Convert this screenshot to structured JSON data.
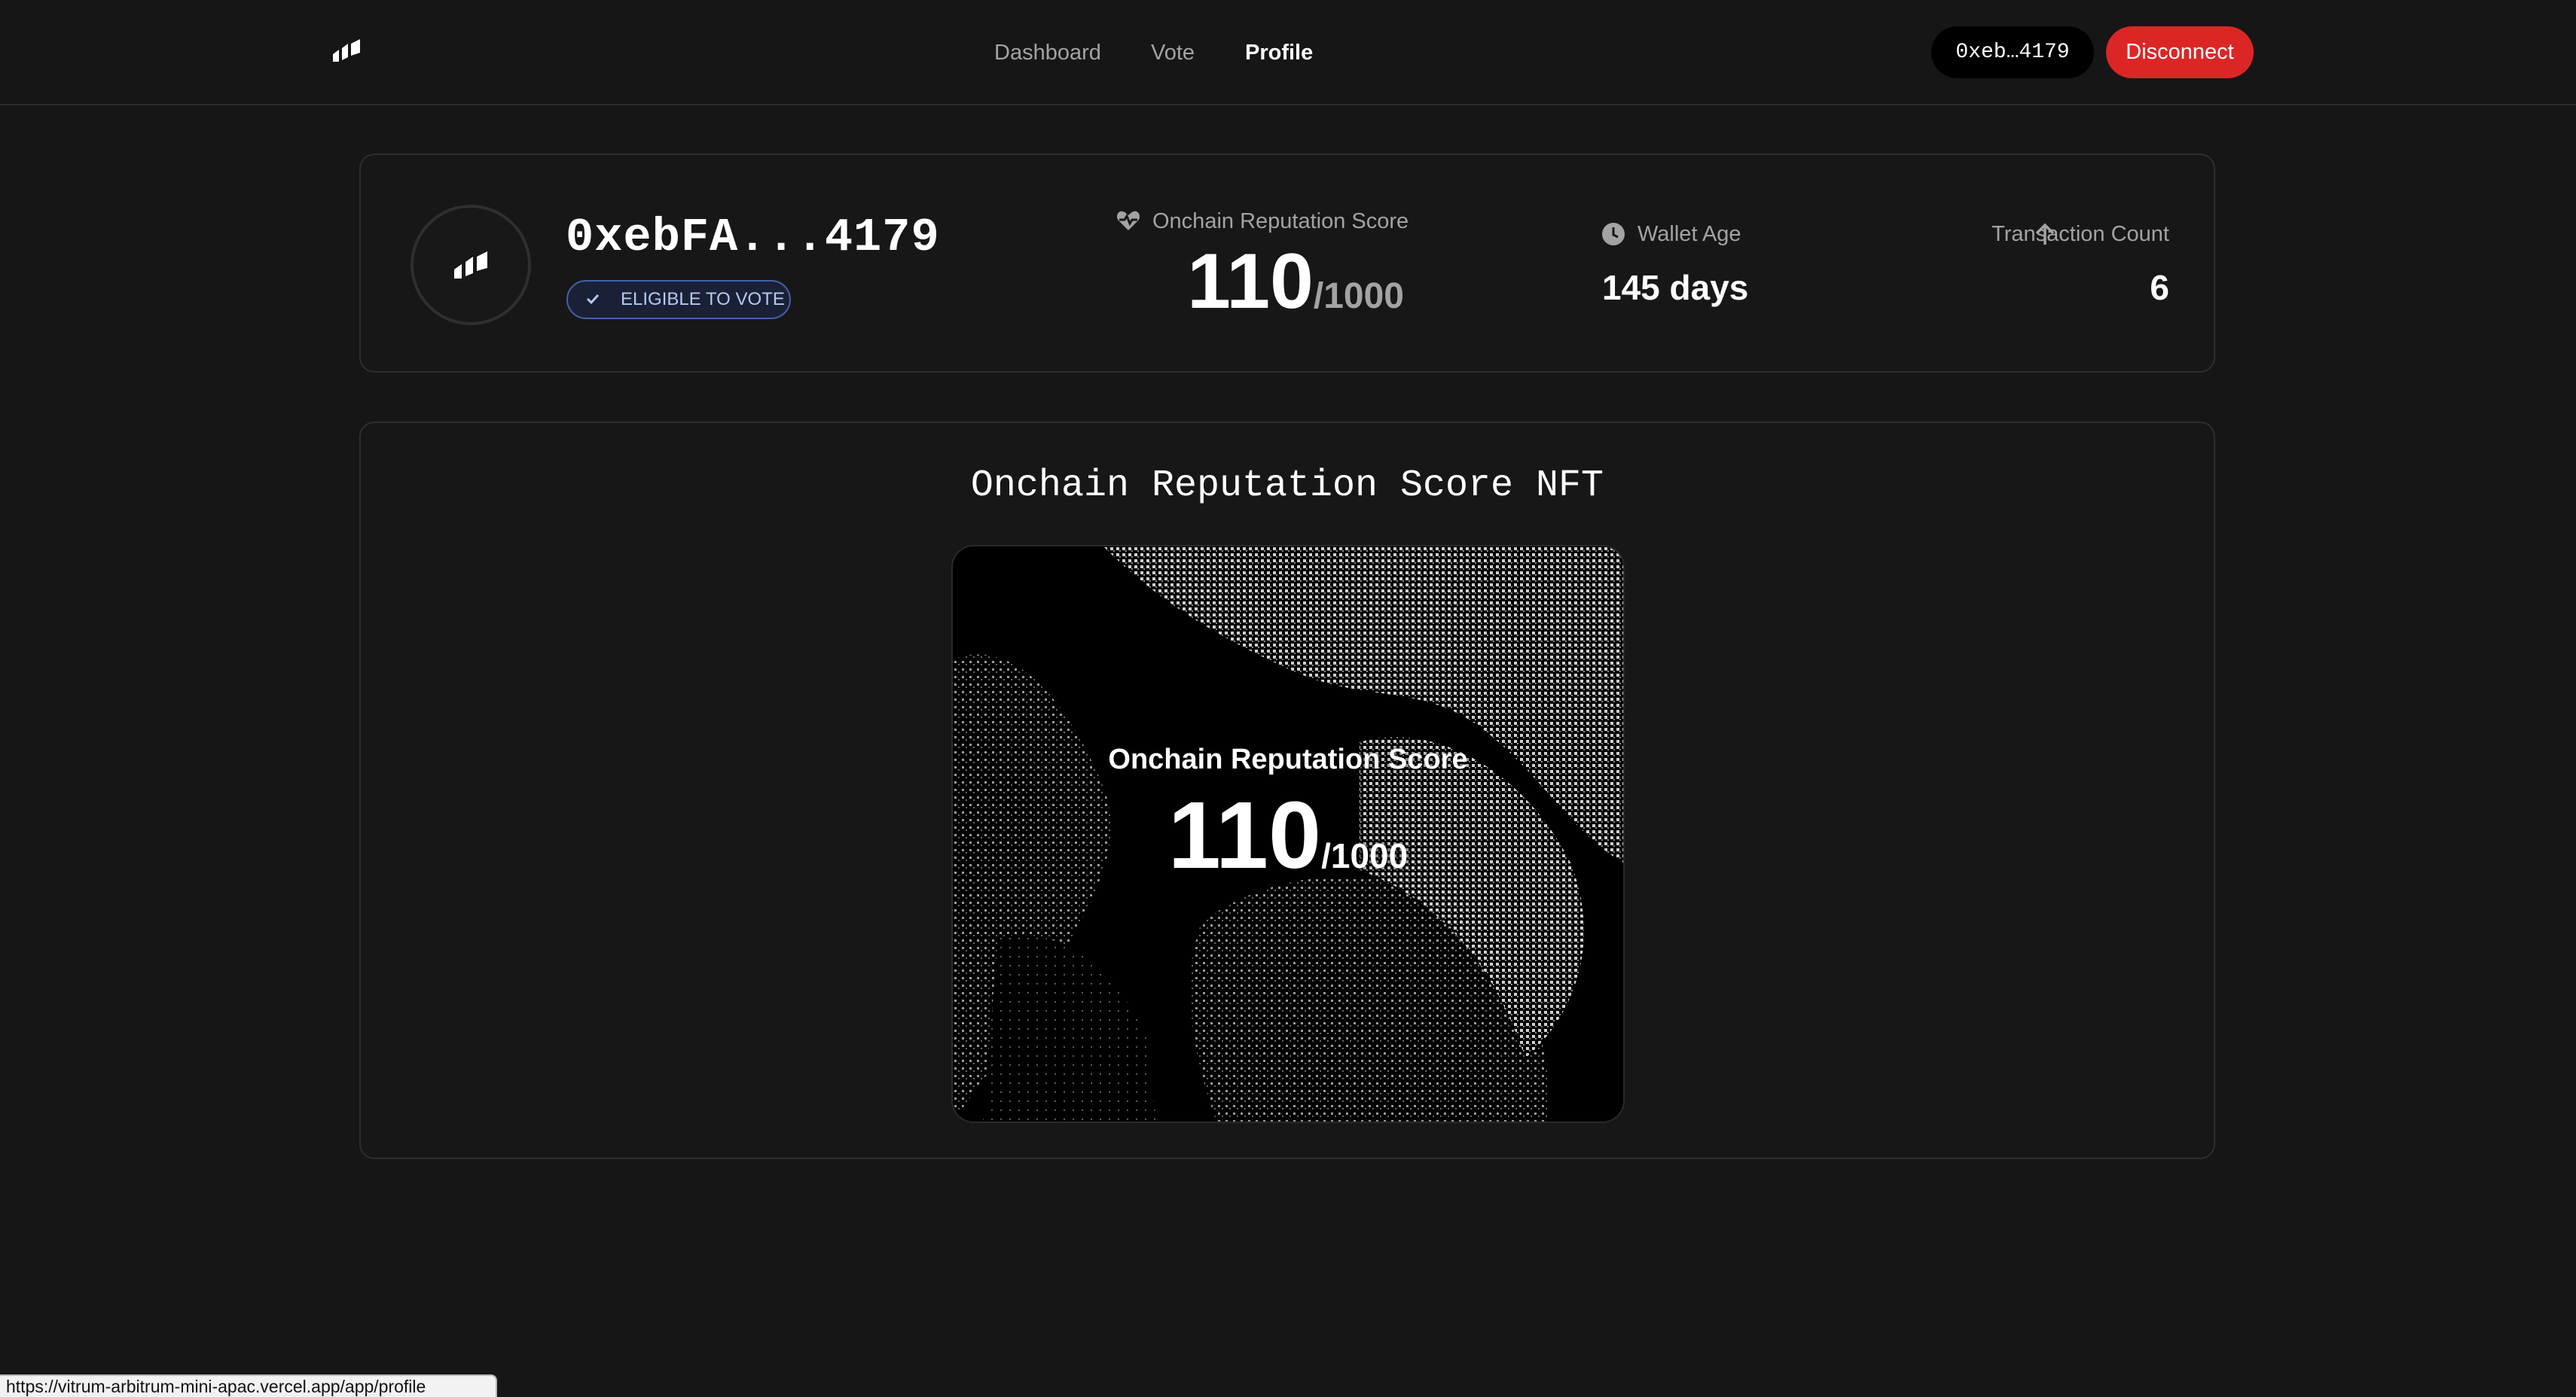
{
  "header": {
    "logo_icon": "bars-logo-icon",
    "nav": [
      {
        "label": "Dashboard",
        "active": false
      },
      {
        "label": "Vote",
        "active": false
      },
      {
        "label": "Profile",
        "active": true
      }
    ],
    "wallet_label": "0xeb…4179",
    "disconnect_label": "Disconnect"
  },
  "profile": {
    "address": "0xebFA...4179",
    "eligible_label": "ELIGIBLE TO VOTE",
    "score_label": "Onchain Reputation Score",
    "score_value": "110",
    "score_max": "/1000",
    "wallet_age_label": "Wallet Age",
    "wallet_age_value": "145 days",
    "tx_count_label": "Transaction Count",
    "tx_count_value": "6"
  },
  "nft": {
    "title": "Onchain Reputation Score NFT",
    "overlay_label": "Onchain Reputation Score",
    "overlay_score": "110",
    "overlay_max": "/1000"
  },
  "status_url": "https://vitrum-arbitrum-mini-apac.vercel.app/app/profile",
  "colors": {
    "background": "#161616",
    "accent_red": "#dc2626",
    "badge_blue": "#4662a8"
  }
}
